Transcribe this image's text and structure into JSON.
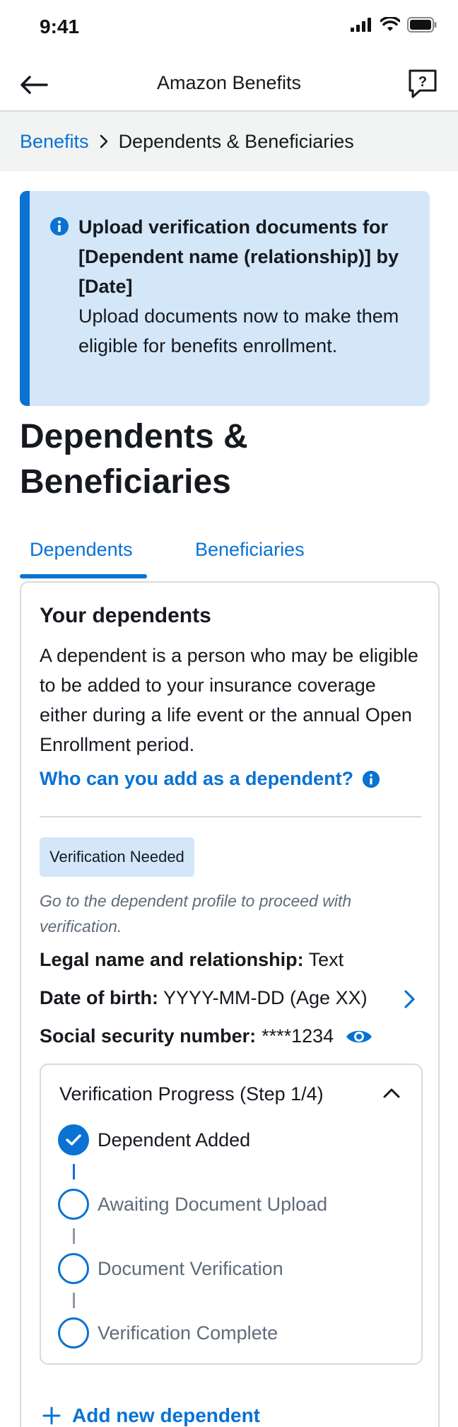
{
  "status_bar": {
    "time": "9:41"
  },
  "nav": {
    "title": "Amazon Benefits"
  },
  "breadcrumb": {
    "parent": "Benefits",
    "current": "Dependents & Beneficiaries"
  },
  "alert": {
    "heading": "Upload verification documents for [Dependent name (relationship)] by [Date]",
    "body": "Upload documents now to make them eligible for benefits enrollment."
  },
  "page": {
    "title": "Dependents & Beneficiaries"
  },
  "tabs": [
    {
      "label": "Dependents",
      "selected": true
    },
    {
      "label": "Beneficiaries",
      "selected": false
    }
  ],
  "card": {
    "title": "Your dependents",
    "description": "A dependent is a person who may be eligible to be added to your insurance coverage either during a life event or the annual Open Enrollment period.",
    "who_link": "Who can you add as a dependent?",
    "badge": "Verification Needed",
    "note": "Go to the dependent profile to proceed with verification.",
    "fields": {
      "name_label": "Legal name and relationship:",
      "name_value": "Text",
      "dob_label": "Date of birth:",
      "dob_value": "YYYY-MM-DD (Age XX)",
      "ssn_label": "Social security number:",
      "ssn_value": "****1234"
    },
    "progress": {
      "title": "Verification Progress (Step 1/4)",
      "steps": [
        {
          "label": "Dependent Added",
          "done": true
        },
        {
          "label": "Awaiting Document Upload",
          "done": false
        },
        {
          "label": "Document Verification",
          "done": false
        },
        {
          "label": "Verification Complete",
          "done": false
        }
      ]
    },
    "add_label": "Add new dependent"
  },
  "colors": {
    "accent": "#0972d3",
    "alert_bg": "#d3e7f9",
    "breadcrumb_bg": "#f2f3f3",
    "text": "#16191f",
    "muted": "#5f6b7a"
  },
  "icons": [
    "back-arrow-icon",
    "feedback-icon",
    "chevron-right-icon",
    "info-icon",
    "eye-icon",
    "chevron-up-icon",
    "check-icon",
    "plus-icon",
    "signal-icon",
    "wifi-icon",
    "battery-icon"
  ]
}
